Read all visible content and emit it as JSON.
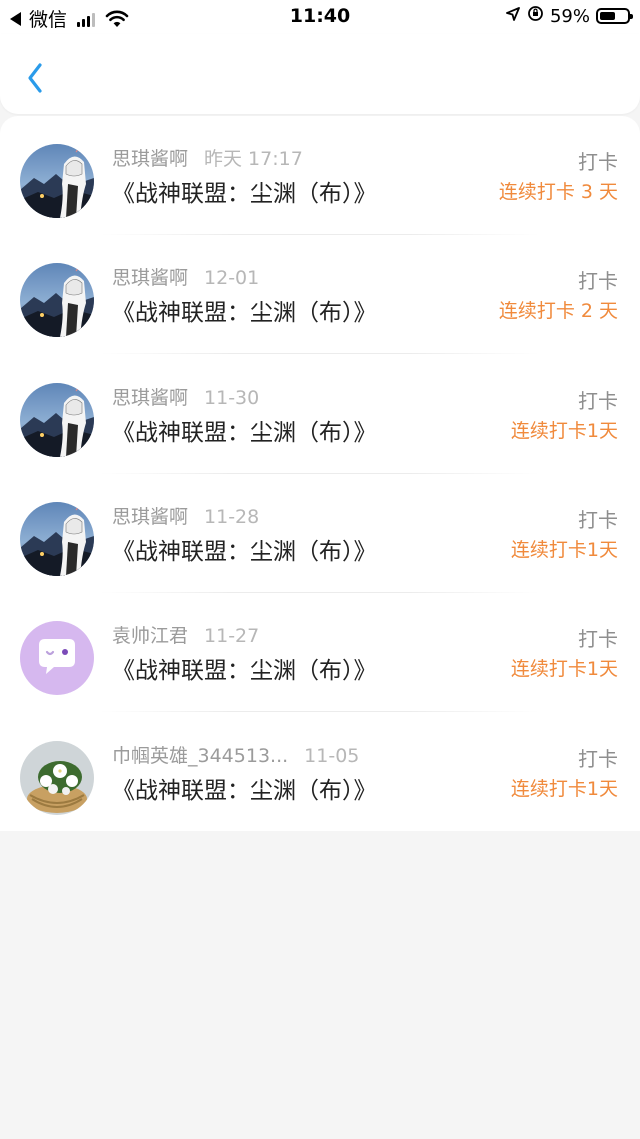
{
  "status_bar": {
    "back_app": "微信",
    "time": "11:40",
    "battery_percent_text": "59%",
    "battery_level": 0.59
  },
  "nav": {
    "back_icon": "chevron-left-icon",
    "accent_color": "#2a9bea"
  },
  "records": [
    {
      "user": "思琪酱啊",
      "time": "昨天 17:17",
      "book": "《战神联盟：尘渊（布）》",
      "action": "打卡",
      "streak": "连续打卡 3 天",
      "avatar": "anime-night-avatar"
    },
    {
      "user": "思琪酱啊",
      "time": "12-01",
      "book": "《战神联盟：尘渊（布）》",
      "action": "打卡",
      "streak": "连续打卡 2 天",
      "avatar": "anime-night-avatar"
    },
    {
      "user": "思琪酱啊",
      "time": "11-30",
      "book": "《战神联盟：尘渊（布）》",
      "action": "打卡",
      "streak": "连续打卡1天",
      "avatar": "anime-night-avatar"
    },
    {
      "user": "思琪酱啊",
      "time": "11-28",
      "book": "《战神联盟：尘渊（布）》",
      "action": "打卡",
      "streak": "连续打卡1天",
      "avatar": "anime-night-avatar"
    },
    {
      "user": "袁帅江君",
      "time": "11-27",
      "book": "《战神联盟：尘渊（布）》",
      "action": "打卡",
      "streak": "连续打卡1天",
      "avatar": "chat-bubble-avatar"
    },
    {
      "user": "巾帼英雄_344513...",
      "time": "11-05",
      "book": "《战神联盟：尘渊（布）》",
      "action": "打卡",
      "streak": "连续打卡1天",
      "avatar": "flower-basket-avatar"
    }
  ],
  "colors": {
    "streak": "#f08a3c",
    "name": "#9b9b9b",
    "title": "#222222",
    "background": "#f5f5f5"
  }
}
